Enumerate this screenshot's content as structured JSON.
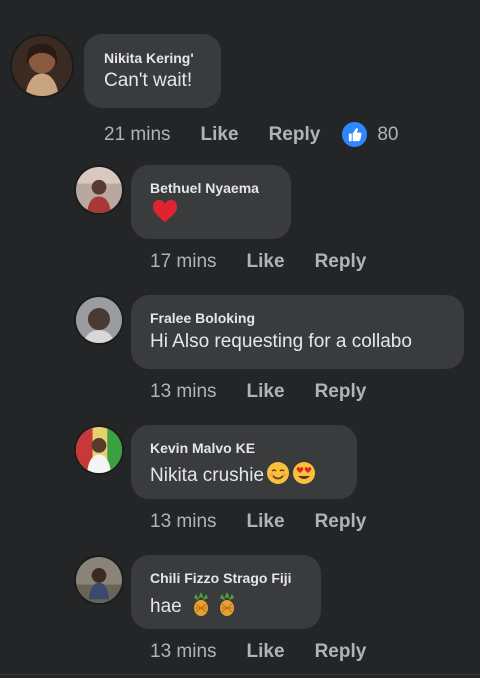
{
  "comments": [
    {
      "author": "Nikita Kering'",
      "text": "Can't wait!",
      "time": "21 mins",
      "like_label": "Like",
      "reply_label": "Reply",
      "reaction_icon": "thumbs-up-icon",
      "reaction_count": "80",
      "avatar_color": "#5a3a2a"
    },
    {
      "author": "Bethuel Nyaema",
      "text": "",
      "emoji": [
        "red-heart-emoji"
      ],
      "time": "17 mins",
      "like_label": "Like",
      "reply_label": "Reply",
      "avatar_color": "#8a6a60"
    },
    {
      "author": "Fralee Boloking",
      "text": "Hi Also requesting for a collabo",
      "time": "13 mins",
      "like_label": "Like",
      "reply_label": "Reply",
      "avatar_color": "#6a6c72"
    },
    {
      "author": "Kevin Malvo KE",
      "text": "Nikita crushie",
      "emoji": [
        "smiling-face-emoji",
        "heart-eyes-emoji"
      ],
      "time": "13 mins",
      "like_label": "Like",
      "reply_label": "Reply",
      "avatar_color": "#c8a060"
    },
    {
      "author": "Chili Fizzo Strago Fiji",
      "text": "hae",
      "emoji": [
        "pineapple-emoji",
        "pineapple-emoji"
      ],
      "time": "13 mins",
      "like_label": "Like",
      "reply_label": "Reply",
      "avatar_color": "#7a7060"
    }
  ]
}
